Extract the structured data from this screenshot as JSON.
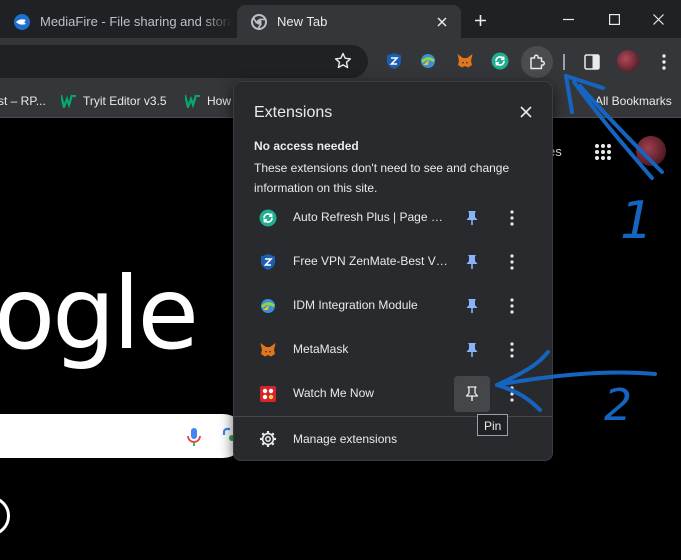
{
  "tabs": [
    {
      "title": "MediaFire - File sharing and storage made simple",
      "favicon": "mediafire-icon",
      "active": false
    },
    {
      "title": "New Tab",
      "favicon": "chrome-icon",
      "active": true
    }
  ],
  "toolbar": {
    "extension_icons": [
      "zenmate-vpn-icon",
      "idm-icon",
      "metamask-icon",
      "auto-refresh-icon"
    ],
    "puzzle_icon": "puzzle-icon"
  },
  "bookmarks": {
    "items": [
      {
        "label": "st – RP..."
      },
      {
        "label": "Tryit Editor v3.5"
      },
      {
        "label": "How"
      }
    ],
    "all_bookmarks": "All Bookmarks"
  },
  "page": {
    "logo_partial": "ogle",
    "images_link": "es"
  },
  "popup": {
    "title": "Extensions",
    "section_heading": "No access needed",
    "section_description": "These extensions don't need to see and change information on this site.",
    "extensions": [
      {
        "name": "Auto Refresh Plus | Page Monitor",
        "icon": "auto-refresh-icon",
        "pinned": true
      },
      {
        "name": "Free VPN ZenMate-Best VPN for Chrome",
        "icon": "zenmate-vpn-icon",
        "pinned": true
      },
      {
        "name": "IDM Integration Module",
        "icon": "idm-icon",
        "pinned": true
      },
      {
        "name": "MetaMask",
        "icon": "metamask-icon",
        "pinned": true
      },
      {
        "name": "Watch Me Now",
        "icon": "watch-me-now-icon",
        "pinned": false
      }
    ],
    "manage_label": "Manage extensions",
    "tooltip": "Pin"
  },
  "annotations": {
    "labels": [
      "1",
      "2"
    ],
    "color": "#1565c0"
  },
  "colors": {
    "pinned": "#8ab4f8",
    "background": "#292a2d",
    "accent": "#1a73e8"
  }
}
